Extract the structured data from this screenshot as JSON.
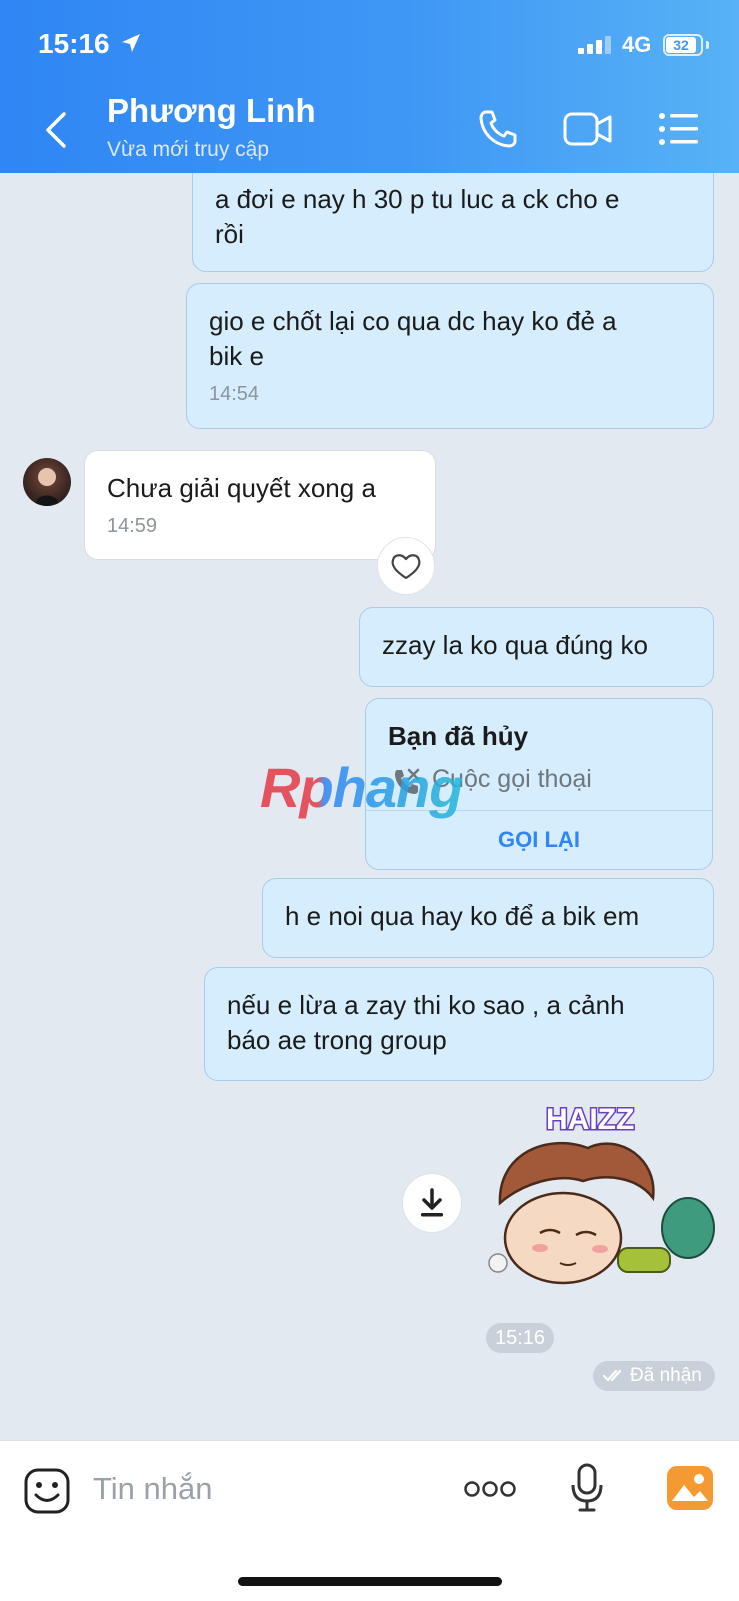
{
  "status_bar": {
    "time": "15:16",
    "network": "4G",
    "battery": "32"
  },
  "header": {
    "contact_name": "Phương Linh",
    "contact_status": "Vừa mới truy cập"
  },
  "messages": [
    {
      "direction": "out",
      "text_line1": "a đơi e nay h 30 p tu luc a ck cho e",
      "text_line2": "rồi"
    },
    {
      "direction": "out",
      "text_line1": "gio e chốt lại co qua dc hay ko đẻ a",
      "text_line2": "bik e",
      "time": "14:54"
    },
    {
      "direction": "in",
      "text": "Chưa giải quyết xong a",
      "time": "14:59"
    },
    {
      "direction": "out",
      "text": "zzay la ko qua đúng ko"
    },
    {
      "direction": "out",
      "text": "h e noi qua hay ko để a bik em"
    },
    {
      "direction": "out",
      "text_line1": "nếu e lừa a zay thi ko sao ,  a cảnh",
      "text_line2": "báo ae trong group"
    }
  ],
  "call_card": {
    "title": "Bạn đã hủy",
    "subtitle": "Cuộc gọi thoại",
    "action": "GỌI LẠI"
  },
  "watermark": "Rphang",
  "sticker": {
    "caption": "HAIZZ"
  },
  "chat_footer": {
    "time": "15:16",
    "receipt": "Đã nhận"
  },
  "input": {
    "placeholder": "Tin nhắn"
  },
  "colors": {
    "header_start": "#2f86f4",
    "header_end": "#58b2f5",
    "out_bubble": "#d5edfc",
    "accent": "#2f86f4",
    "chat_bg": "#e2e9f1"
  },
  "icons": [
    "back-icon",
    "phone-icon",
    "video-icon",
    "menu-icon",
    "heart-icon",
    "download-icon",
    "phone-cancel-icon",
    "sticker-icon",
    "more-icon",
    "mic-icon",
    "gallery-icon"
  ]
}
